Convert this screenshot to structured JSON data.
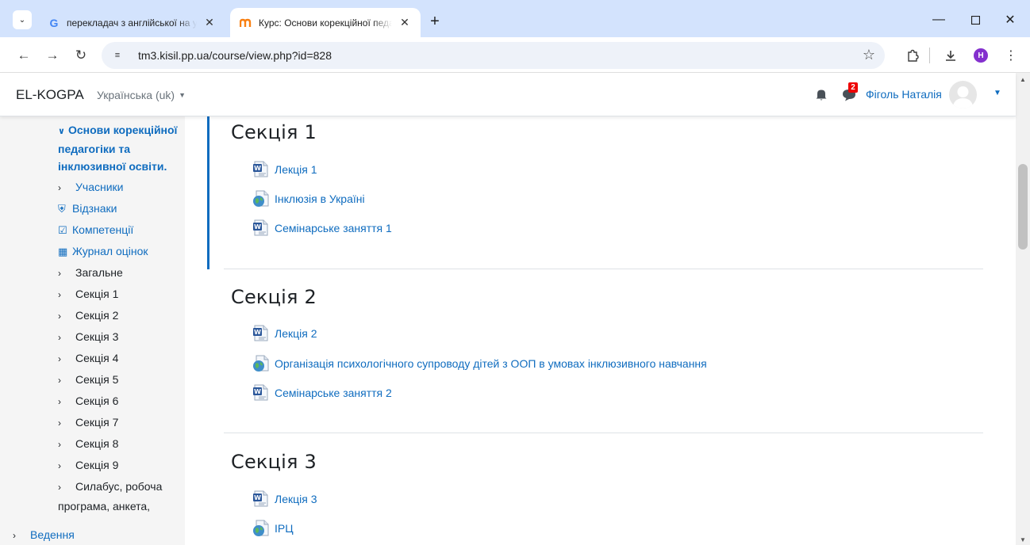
{
  "browser": {
    "tabs": [
      {
        "title": "перекладач з англійської на ук",
        "favicon": "google-g-icon",
        "active": false
      },
      {
        "title": "Курс: Основи корекційної педагогіки",
        "favicon": "moodle-icon",
        "active": true
      }
    ],
    "url": "tm3.kisil.pp.ua/course/view.php?id=828",
    "profile_initial": "H"
  },
  "navbar": {
    "brand": "EL-KOGPA",
    "language": "Українська (uk)",
    "message_count": "2",
    "user_name": "Фіголь Наталія"
  },
  "drawer": {
    "course_title": "Основи корекційної педагогіки та інклюзивної освіти.",
    "items": [
      {
        "label": "Учасники",
        "kind": "chevron-link"
      },
      {
        "label": "Відзнаки",
        "kind": "icon-link",
        "icon": "shield-icon"
      },
      {
        "label": "Компетенції",
        "kind": "icon-link",
        "icon": "checkbox-icon"
      },
      {
        "label": "Журнал оцінок",
        "kind": "icon-link",
        "icon": "table-icon"
      },
      {
        "label": "Загальне"
      },
      {
        "label": "Секція 1"
      },
      {
        "label": "Секція 2"
      },
      {
        "label": "Секція 3"
      },
      {
        "label": "Секція 4"
      },
      {
        "label": "Секція 5"
      },
      {
        "label": "Секція 6"
      },
      {
        "label": "Секція 7"
      },
      {
        "label": "Секція 8"
      },
      {
        "label": "Секція 9"
      }
    ],
    "syllabus_line1": "Силабус, робоча",
    "syllabus_line2": "програма, анкета,",
    "last_item": "Ведення"
  },
  "sections": [
    {
      "title": "Секція 1",
      "activities": [
        {
          "label": "Лекція 1",
          "icon": "word-document-icon"
        },
        {
          "label": "Інклюзія в Україні",
          "icon": "url-globe-icon"
        },
        {
          "label": "Семінарське заняття 1",
          "icon": "word-document-icon"
        }
      ]
    },
    {
      "title": "Секція 2",
      "activities": [
        {
          "label": "Лекція 2",
          "icon": "word-document-icon"
        },
        {
          "label": "Організація психологічного супроводу дітей з ООП в умовах інклюзивного навчання",
          "icon": "url-globe-icon"
        },
        {
          "label": "Семінарське заняття 2",
          "icon": "word-document-icon"
        }
      ]
    },
    {
      "title": "Секція 3",
      "activities": [
        {
          "label": "Лекція 3",
          "icon": "word-document-icon"
        },
        {
          "label": "ІРЦ",
          "icon": "url-globe-icon"
        }
      ]
    }
  ],
  "colors": {
    "link": "#0f6cbf",
    "tabstrip": "#d3e3fd",
    "drawer": "#f5f5f5"
  }
}
